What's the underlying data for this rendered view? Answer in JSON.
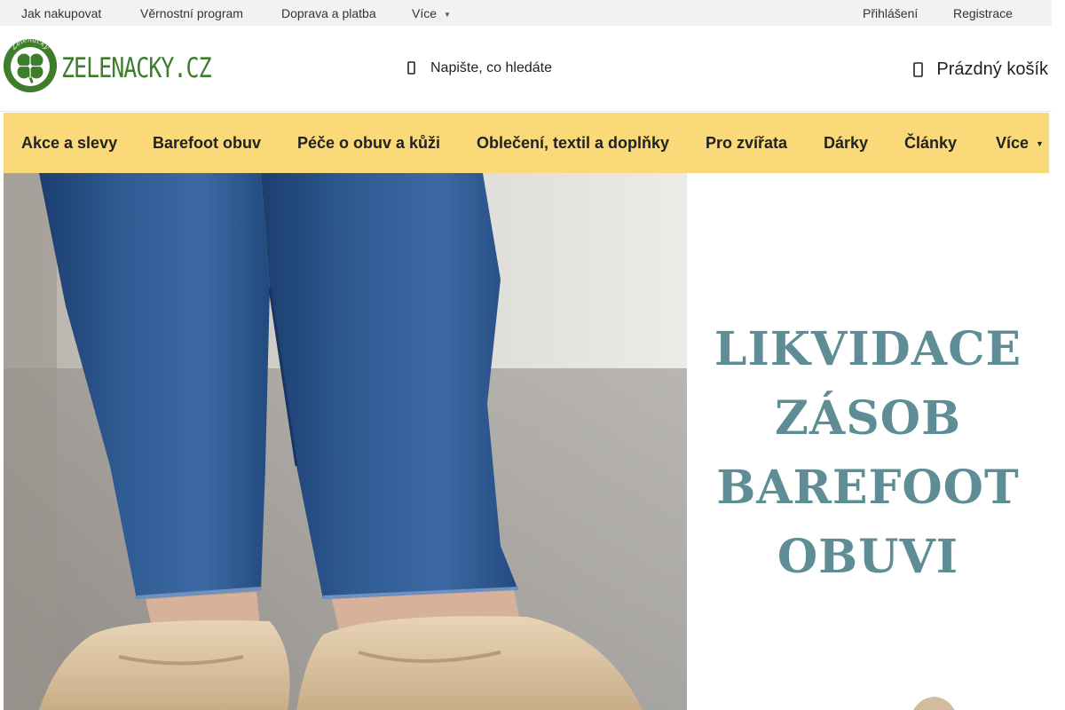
{
  "topbar": {
    "links": [
      "Jak nakupovat",
      "Věrnostní program",
      "Doprava a platba",
      "Více"
    ],
    "account": {
      "login": "Přihlášení",
      "register": "Registrace"
    }
  },
  "header": {
    "logo_text": "ZELENACKY.CZ",
    "logo_badge": "Zelenáčky",
    "search_placeholder": "Napište, co hledáte",
    "cart_label": "Prázdný košík"
  },
  "nav": {
    "items": [
      "Akce a slevy",
      "Barefoot obuv",
      "Péče o obuv a kůži",
      "Oblečení, textil a doplňky",
      "Pro zvířata",
      "Dárky",
      "Články",
      "Více"
    ]
  },
  "hero": {
    "headline_lines": [
      "LIKVIDACE",
      "ZÁSOB",
      "BAREFOOT",
      "OBUVI"
    ]
  },
  "colors": {
    "nav_background": "#f9d978",
    "brand_green": "#3e7d2a",
    "headline": "#5f8d96",
    "topbar_background": "#f2f2f2"
  },
  "icons": {
    "search": "search-icon",
    "cart": "cart-icon",
    "caret": "caret-down-icon",
    "logo": "clover-icon"
  }
}
